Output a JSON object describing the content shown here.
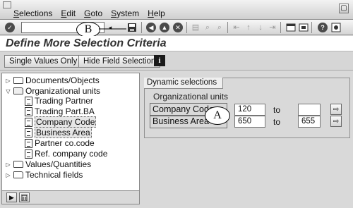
{
  "menu": {
    "items": [
      "Selections",
      "Edit",
      "Goto",
      "System",
      "Help"
    ]
  },
  "toolbar": {
    "command_value": ""
  },
  "callouts": {
    "b": "B",
    "a": "A"
  },
  "page": {
    "title": "Define More Selection Criteria"
  },
  "app_toolbar": {
    "single_values_label": "Single Values Only",
    "hide_field_label": "Hide Field Selection",
    "info_label": "i"
  },
  "tree": {
    "documents": "Documents/Objects",
    "org_units": "Organizational units",
    "trading_partner": "Trading Partner",
    "trading_part_ba": "Trading Part.BA",
    "company_code": "Company Code",
    "business_area": "Business Area",
    "partner_co_code": "Partner co.code",
    "ref_company_code": "Ref. company code",
    "values_quantities": "Values/Quantities",
    "technical_fields": "Technical fields"
  },
  "dynamic": {
    "tab_label": "Dynamic selections",
    "group_label": "Organizational units",
    "to_label": "to",
    "company_code": {
      "label": "Company Code",
      "from": "120",
      "to": ""
    },
    "business_area": {
      "label": "Business Area",
      "from": "650",
      "to": "655"
    }
  }
}
